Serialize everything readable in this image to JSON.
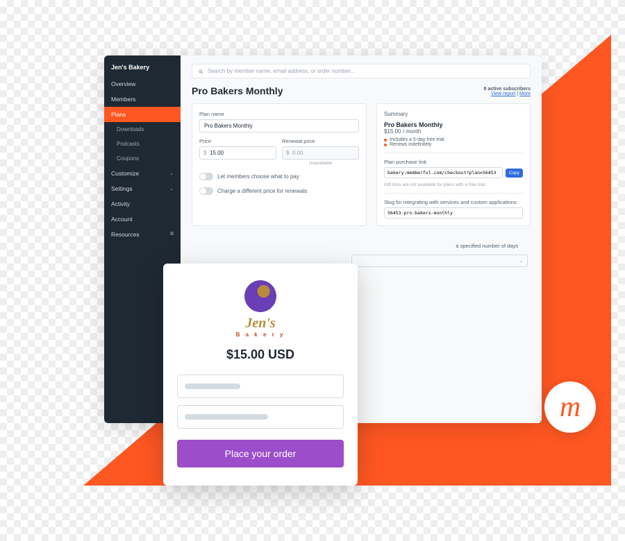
{
  "colors": {
    "accent": "#ff5722",
    "cta": "#9b4dca",
    "link": "#2d6cdf"
  },
  "sidebar": {
    "workspace": "Jen's Bakery",
    "items": [
      {
        "label": "Overview"
      },
      {
        "label": "Members"
      },
      {
        "label": "Plans",
        "active": true
      },
      {
        "label": "Downloads",
        "sub": true
      },
      {
        "label": "Podcasts",
        "sub": true
      },
      {
        "label": "Coupons",
        "sub": true
      },
      {
        "label": "Customize",
        "chevron": true
      },
      {
        "label": "Settings",
        "chevron": true
      },
      {
        "label": "Activity"
      },
      {
        "label": "Account"
      },
      {
        "label": "Resources",
        "external": true
      }
    ]
  },
  "search": {
    "placeholder": "Search by member name, email address, or order number..."
  },
  "page": {
    "title": "Pro Bakers Monthly",
    "subscribers": "8 active subscribers",
    "view_report": "View report",
    "more": "More"
  },
  "form": {
    "plan_name_label": "Plan name",
    "plan_name_value": "Pro Bakers Monthly",
    "price_label": "Price",
    "price_value": "15.00",
    "renewal_label": "Renewal price",
    "renewal_value": "0.00",
    "unavailable": "Unavailable",
    "toggle1": "Let members choose what to pay",
    "toggle2": "Charge a different price for renewals"
  },
  "summary": {
    "heading": "Summary",
    "title": "Pro Bakers Monthly",
    "price": "$15.00 / month",
    "bullet1": "Includes a 5-day free trial",
    "bullet2": "Renews indefinitely",
    "purchase_label": "Plan purchase link",
    "purchase_url": "bakery.memberful.com/checkout?plan=56453",
    "copy": "Copy",
    "gift_note": "Gift links are not available for plans with a free trial.",
    "slug_label": "Slug for integrating with services and custom applications:",
    "slug_value": "56453-pro-bakers-monthly"
  },
  "peek": {
    "text": "a specified number of days",
    "select": ""
  },
  "checkout": {
    "brand": "Jen's",
    "brand_sub": "B a k e r y",
    "amount": "$15.00 USD",
    "cta": "Place your order"
  },
  "badge": {
    "glyph": "m"
  }
}
